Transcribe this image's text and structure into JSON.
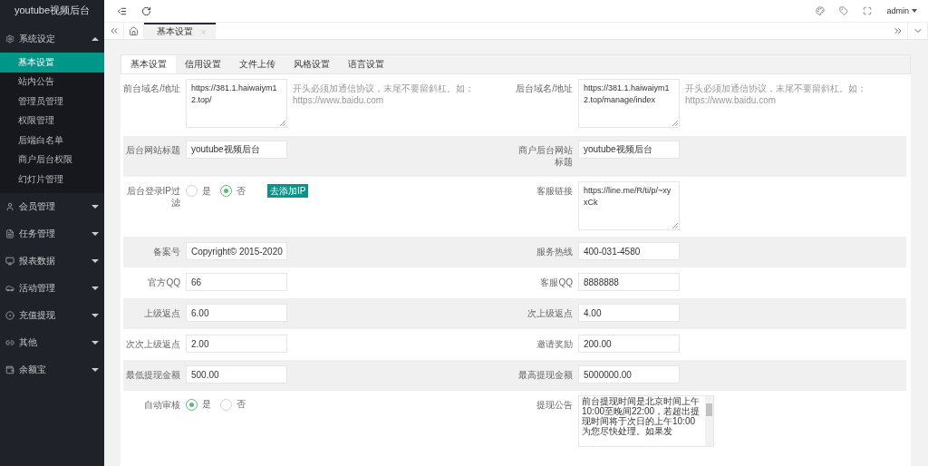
{
  "sidebar": {
    "title": "youtube视频后台",
    "groups": [
      {
        "label": "系统设定",
        "expanded": true,
        "children": [
          {
            "label": "基本设置",
            "selected": true
          },
          {
            "label": "站内公告",
            "selected": false
          },
          {
            "label": "管理员管理",
            "selected": false
          },
          {
            "label": "权限管理",
            "selected": false
          },
          {
            "label": "后端白名单",
            "selected": false
          },
          {
            "label": "商户后台权限",
            "selected": false
          },
          {
            "label": "幻灯片管理",
            "selected": false
          }
        ]
      },
      {
        "label": "会员管理",
        "expanded": false
      },
      {
        "label": "任务管理",
        "expanded": false
      },
      {
        "label": "报表数据",
        "expanded": false
      },
      {
        "label": "活动管理",
        "expanded": false
      },
      {
        "label": "充值提现",
        "expanded": false
      },
      {
        "label": "其他",
        "expanded": false
      },
      {
        "label": "余额宝",
        "expanded": false
      }
    ]
  },
  "header": {
    "user": "admin"
  },
  "page_tabs": [
    {
      "label": "基本设置",
      "selected": true
    }
  ],
  "form_tabs": [
    {
      "label": "基本设置",
      "selected": true
    },
    {
      "label": "信用设置",
      "selected": false
    },
    {
      "label": "文件上传",
      "selected": false
    },
    {
      "label": "风格设置",
      "selected": false
    },
    {
      "label": "语言设置",
      "selected": false
    }
  ],
  "rows": [
    {
      "cells": [
        {
          "kind": "textarea",
          "label": "前台域名/地址",
          "value": "https://381.1.haiwaiym12.top/",
          "hint": "开头必须加通信协议，末尾不要留斜杠。如：https://www.baidu.com"
        },
        {
          "kind": "textarea",
          "label": "后台域名/地址",
          "value": "https://381.1.haiwaiym12.top/manage/index",
          "hint": "开头必须加通信协议，末尾不要留斜杠。如：https://www.baidu.com"
        }
      ]
    },
    {
      "cells": [
        {
          "kind": "input",
          "label": "后台网站标题",
          "value": "youtube视频后台"
        },
        {
          "kind": "input",
          "label": "商户后台网站标题",
          "value": "youtube视频后台"
        }
      ]
    },
    {
      "cells": [
        {
          "kind": "radio",
          "label": "后台登录IP过滤",
          "options": [
            {
              "label": "是",
              "selected": false
            },
            {
              "label": "否",
              "selected": true
            }
          ],
          "button": "去添加IP"
        },
        {
          "kind": "textarea",
          "label": "客服链接",
          "value": "https://line.me/R/ti/p/~xyxCk"
        }
      ]
    },
    {
      "cells": [
        {
          "kind": "input",
          "label": "备案号",
          "value": "Copyright© 2015-2020"
        },
        {
          "kind": "input",
          "label": "服务热线",
          "value": "400-031-4580"
        }
      ]
    },
    {
      "cells": [
        {
          "kind": "input",
          "label": "官方QQ",
          "value": "66"
        },
        {
          "kind": "input",
          "label": "客服QQ",
          "value": "8888888"
        }
      ]
    },
    {
      "cells": [
        {
          "kind": "input",
          "label": "上级返点",
          "value": "6.00"
        },
        {
          "kind": "input",
          "label": "次上级返点",
          "value": "4.00"
        }
      ]
    },
    {
      "cells": [
        {
          "kind": "input",
          "label": "次次上级返点",
          "value": "2.00"
        },
        {
          "kind": "input",
          "label": "邀请奖励",
          "value": "200.00"
        }
      ]
    },
    {
      "cells": [
        {
          "kind": "input",
          "label": "最低提现金额",
          "value": "500.00"
        },
        {
          "kind": "input",
          "label": "最高提现金额",
          "value": "5000000.00"
        }
      ]
    },
    {
      "cells": [
        {
          "kind": "radio",
          "label": "自动审核",
          "options": [
            {
              "label": "是",
              "selected": true
            },
            {
              "label": "否",
              "selected": false
            }
          ]
        },
        {
          "kind": "notice",
          "label": "提现公告",
          "value": "前台提现时间是北京时间上午10:00至晚间22:00，若超出提现时间将于次日的上午10:00为您尽快处理。如果发"
        }
      ]
    }
  ]
}
